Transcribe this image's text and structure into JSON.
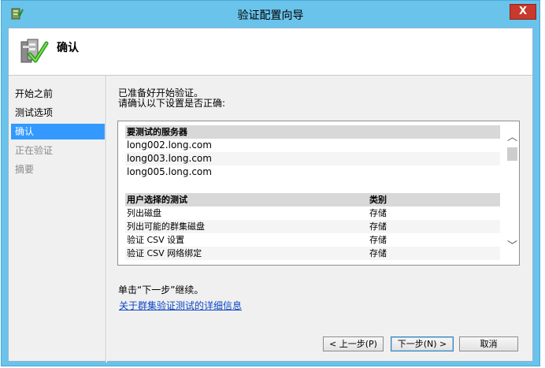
{
  "window": {
    "title": "验证配置向导",
    "close_symbol": "X"
  },
  "header": {
    "title": "确认",
    "icon": "checklist-check-icon"
  },
  "nav": {
    "items": [
      {
        "label": "开始之前",
        "state": "normal"
      },
      {
        "label": "测试选项",
        "state": "normal"
      },
      {
        "label": "确认",
        "state": "selected"
      },
      {
        "label": "正在验证",
        "state": "disabled"
      },
      {
        "label": "摘要",
        "state": "disabled"
      }
    ]
  },
  "main": {
    "intro_line1": "已准备好开始验证。",
    "intro_line2": "请确认以下设置是否正确:",
    "servers": {
      "header": "要测试的服务器",
      "items": [
        "long002.long.com",
        "long003.long.com",
        "long005.long.com"
      ]
    },
    "tests": {
      "col_test": "用户选择的测试",
      "col_category": "类别",
      "rows": [
        {
          "test": "列出磁盘",
          "category": "存储"
        },
        {
          "test": "列出可能的群集磁盘",
          "category": "存储"
        },
        {
          "test": "验证 CSV 设置",
          "category": "存储"
        },
        {
          "test": "验证 CSV 网络绑定",
          "category": "存储"
        }
      ]
    },
    "continue_text": "单击“下一步”继续。",
    "details_link": "关于群集验证测试的详细信息"
  },
  "buttons": {
    "back": "< 上一步(P)",
    "next": "下一步(N) >",
    "cancel": "取消"
  },
  "colors": {
    "title_bar": "#6ac3eb",
    "selected_nav": "#3399ff",
    "link": "#0d47c6",
    "close_button": "#c73a2c"
  }
}
